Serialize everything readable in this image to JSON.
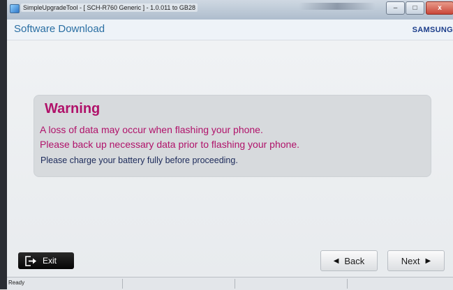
{
  "window": {
    "title": "SimpleUpgradeTool - [ SCH-R760 Generic ] - 1.0.011 to GB28",
    "minimize_glyph": "–",
    "maximize_glyph": "□",
    "close_glyph": "x"
  },
  "header": {
    "title": "Software Download",
    "brand": "SAMSUNG"
  },
  "warning": {
    "title": "Warning",
    "line1": "A loss of data may occur when flashing your phone.",
    "line2": "Please back up necessary data prior to flashing your phone.",
    "note": "Please charge your battery fully before proceeding."
  },
  "buttons": {
    "exit_label": "Exit",
    "back_label": "Back",
    "next_label": "Next"
  },
  "statusbar": {
    "text": "Ready"
  },
  "colors": {
    "warning_accent": "#b0126a",
    "header_title": "#2a6fa3",
    "brand": "#1b3d8b"
  },
  "icons": {
    "app": "app-icon",
    "exit": "exit-icon",
    "back": "left-triangle-icon",
    "next": "right-triangle-icon"
  }
}
